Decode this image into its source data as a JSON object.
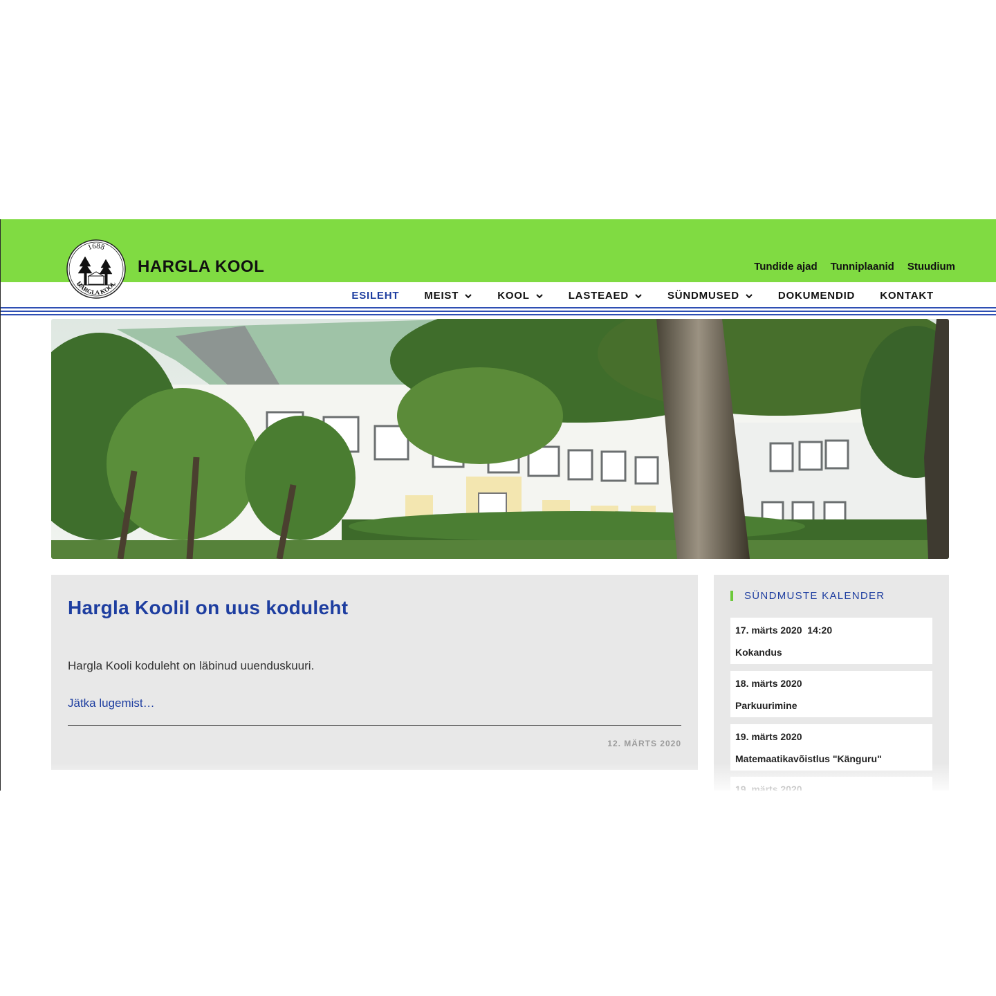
{
  "site": {
    "title": "HARGLA KOOL",
    "logo": {
      "year": "1688",
      "text": "HARGLA KOOL"
    }
  },
  "top_links": [
    "Tundide ajad",
    "Tunniplaanid",
    "Stuudium"
  ],
  "nav": [
    {
      "label": "ESILEHT",
      "active": true,
      "dropdown": false
    },
    {
      "label": "MEIST",
      "active": false,
      "dropdown": true
    },
    {
      "label": "KOOL",
      "active": false,
      "dropdown": true
    },
    {
      "label": "LASTEAED",
      "active": false,
      "dropdown": true
    },
    {
      "label": "SÜNDMUSED",
      "active": false,
      "dropdown": true
    },
    {
      "label": "DOKUMENDID",
      "active": false,
      "dropdown": false
    },
    {
      "label": "KONTAKT",
      "active": false,
      "dropdown": false
    }
  ],
  "post": {
    "title": "Hargla Koolil on uus koduleht",
    "excerpt": "Hargla Kooli koduleht on läbinud uuenduskuuri.",
    "more": "Jätka lugemist…",
    "date": "12. MÄRTS 2020"
  },
  "sidebar": {
    "heading": "SÜNDMUSTE KALENDER",
    "events": [
      {
        "date": "17. märts 2020  14:20",
        "title": "Kokandus"
      },
      {
        "date": "18. märts 2020",
        "title": "Parkuurimine"
      },
      {
        "date": "19. märts 2020",
        "title": "Matemaatikavõistlus \"Känguru\""
      },
      {
        "date": "19. märts 2020",
        "title": ""
      }
    ]
  },
  "colors": {
    "brand_green": "#80db42",
    "link_blue": "#1e3ea0",
    "panel_grey": "#e8e8e8"
  }
}
